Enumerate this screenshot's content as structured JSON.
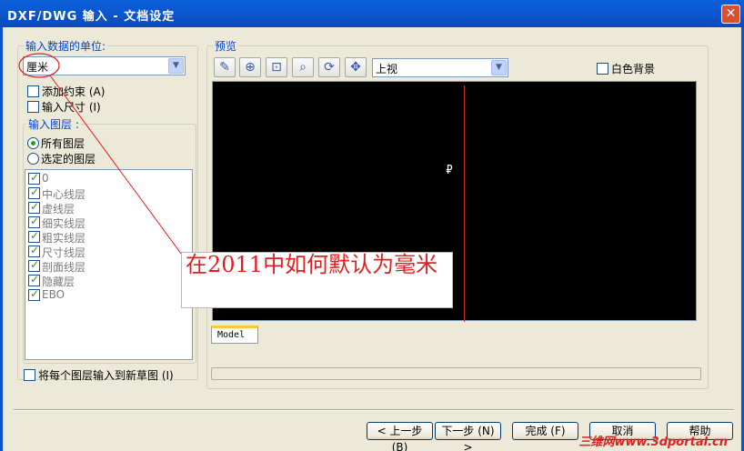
{
  "window": {
    "title": "DXF/DWG 输入 - 文档设定",
    "close_glyph": "✕"
  },
  "units": {
    "group_label": "输入数据的单位:",
    "selected": "厘米"
  },
  "options": {
    "add_constraints": "添加约束 (A)",
    "import_dimensions": "输入尺寸 (I)"
  },
  "layers": {
    "group_label": "输入图层 :",
    "radio_all": "所有图层",
    "radio_selected": "选定的图层",
    "items": [
      "0",
      "中心线层",
      "虚线层",
      "细实线层",
      "粗实线层",
      "尺寸线层",
      "剖面线层",
      "隐藏层",
      "EBO"
    ]
  },
  "each_layer_new_sketch": "将每个图层输入到新草图 (I)",
  "preview": {
    "group_label": "预览",
    "view_selected": "上视",
    "white_background": "白色背景",
    "tab_label": "Model",
    "toolbar_icons": [
      "select-tool-icon",
      "zoom-in-icon",
      "zoom-fit-icon",
      "zoom-area-icon",
      "rotate-icon",
      "pan-icon"
    ]
  },
  "buttons": {
    "back": "< 上一步 (B)",
    "next": "下一步 (N) >",
    "finish": "完成 (F)",
    "cancel": "取消",
    "help": "帮助"
  },
  "annotation": "在2011中如何默认为毫米",
  "watermark": "三维网www.3dportal.cn",
  "colors": {
    "title_bar": "#0a52d0",
    "annotation_text": "#e02020",
    "preview_bg": "#000000",
    "preview_line": "#d0301f"
  }
}
